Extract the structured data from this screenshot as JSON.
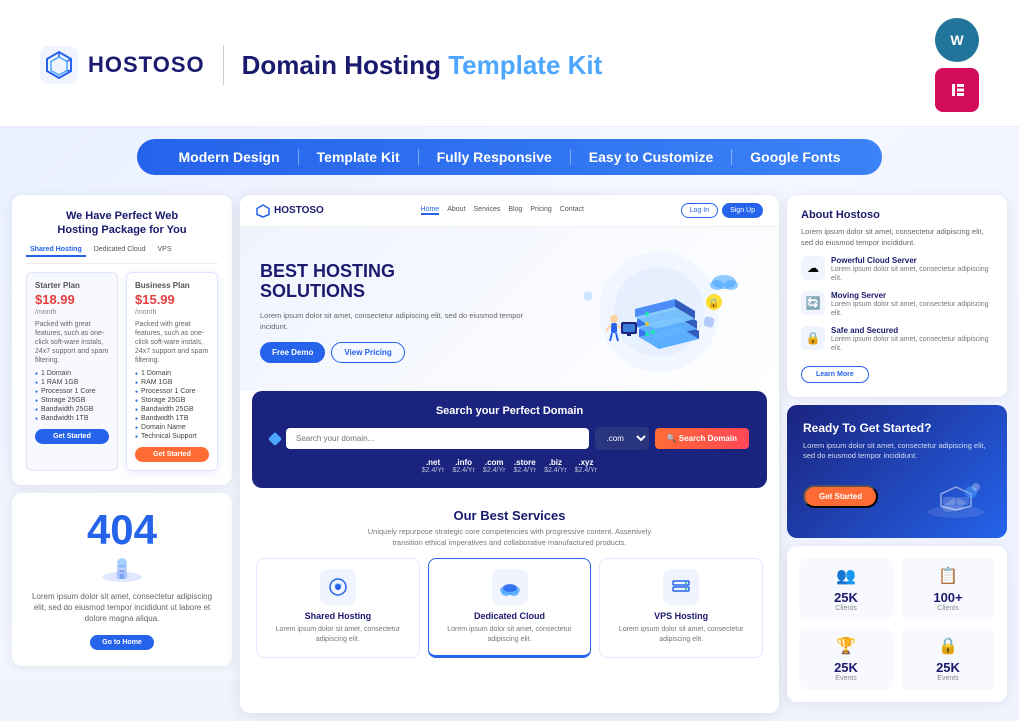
{
  "header": {
    "logo_text": "HOSTOSO",
    "title": "Domain Hosting",
    "title_colored": "Template Kit",
    "wp_badge": "W",
    "el_badge": "≡"
  },
  "nav_pills": {
    "items": [
      {
        "label": "Modern Design"
      },
      {
        "label": "Template Kit"
      },
      {
        "label": "Fully Responsive"
      },
      {
        "label": "Easy to Customize"
      },
      {
        "label": "Google Fonts"
      }
    ]
  },
  "site": {
    "nav_links": [
      {
        "label": "Home",
        "active": true
      },
      {
        "label": "About"
      },
      {
        "label": "Services"
      },
      {
        "label": "Blog"
      },
      {
        "label": "Pricing"
      },
      {
        "label": "Contact"
      }
    ],
    "nav_btns": [
      {
        "label": "Log In",
        "type": "outline"
      },
      {
        "label": "Sign Up",
        "type": "filled"
      }
    ],
    "hero": {
      "title": "BEST HOSTING SOLUTIONS",
      "desc": "Lorem ipsum dolor sit amet, consectetur adipiscing elit, sed do eiusmod tempor incidunt.",
      "btn1": "Free Demo",
      "btn2": "View Pricing"
    },
    "domain_search": {
      "title": "Search your Perfect Domain",
      "placeholder": "Search your domain...",
      "btn": "Search Domain",
      "select": ".com",
      "tlds": [
        {
          "name": ".net",
          "price": "$2.4/Yr"
        },
        {
          "name": ".info",
          "price": "$2.4/Yr"
        },
        {
          "name": ".com",
          "price": "$2.4/Yr"
        },
        {
          "name": ".store",
          "price": "$2.4/Yr"
        },
        {
          "name": ".biz",
          "price": "$2.4/Yr"
        },
        {
          "name": ".xyz",
          "price": "$2.4/Yr"
        }
      ]
    },
    "services": {
      "title": "Our Best Services",
      "desc": "Uniquely repurpose strategic core competencies with progressive content. Assertively transition ethical imperatives and collaborative manufactured products.",
      "cards": [
        {
          "icon": "🛡",
          "name": "Shared Hosting",
          "desc": "Lorem ipsum dolor sit amet, consectetur adipiscing elit."
        },
        {
          "icon": "☁",
          "name": "Dedicated Cloud",
          "desc": "Lorem ipsum dolor sit amet, consectetur adipiscing elit."
        },
        {
          "icon": "🖥",
          "name": "VPS Hosting",
          "desc": "Lorem ipsum dolor sit amet, consectetur adipiscing elit."
        }
      ]
    }
  },
  "pricing": {
    "title": "We Have Perfect Web Hosting Package for You",
    "tabs": [
      "Shared Hosting",
      "Dedicated Cloud",
      "VPS"
    ],
    "plans": [
      {
        "name": "Starter Plan",
        "price": "$18.99",
        "period": "/month",
        "desc": "Packed with great features, such as one-click soft-ware instals, 24x7 support and spam filtering.",
        "features": [
          "1 Domain",
          "1 RAM 1GB",
          "Processor 1 Core",
          "Storage 25GB",
          "Bandwidth 25GB",
          "Bandwidth 1TB"
        ]
      },
      {
        "name": "Business Plan",
        "price": "$15.99",
        "period": "/month",
        "desc": "Packed with great features, such as one-click soft-ware instals, 24x7 support and spam filtering.",
        "features": [
          "1 Domain",
          "RAM 1GB",
          "Processor 1 Core",
          "Storage 25GB",
          "Bandwidth 25GB",
          "Bandwidth 1TB",
          "Domain Name",
          "Technical Support"
        ]
      }
    ],
    "btn": "Get Started"
  },
  "about": {
    "title": "About Hostoso",
    "desc": "Lorem ipsum dolor sit amet, consectetur adipiscing elit, sed do eiusmod tempor incididunt.",
    "features": [
      {
        "icon": "☁",
        "name": "Powerful Cloud Server",
        "desc": "Lorem ipsum dolor sit amet, consectetur adipiscing elit."
      },
      {
        "icon": "🔄",
        "name": "Moving Server",
        "desc": "Lorem ipsum dolor sit amet, consectetur adipiscing elit."
      },
      {
        "icon": "🔒",
        "name": "Safe and Secured",
        "desc": "Lorem ipsum dolor sit amet, consectetur adipiscing elit."
      }
    ],
    "btn": "Learn More"
  },
  "cta": {
    "title": "Ready To Get Started?",
    "desc": "Lorem ipsum dolor sit amet, consectetur adipiscing elit, sed do eiusmod tempor incididunt.",
    "btn": "Get Started"
  },
  "stats": {
    "items": [
      {
        "icon": "👥",
        "num": "25K",
        "label": "Clients"
      },
      {
        "icon": "📋",
        "num": "100+",
        "label": "Clients"
      },
      {
        "icon": "🏆",
        "num": "25K",
        "label": "Events"
      },
      {
        "icon": "🔒",
        "num": "25K",
        "label": "Events"
      }
    ]
  },
  "error_page": {
    "code": "404",
    "desc": "Lorem ipsum dolor sit amet, consectetur adipiscing elit, sed do eiusmod tempor incididunt ut labore et dolore magna aliqua.",
    "btn": "Go to Home"
  }
}
